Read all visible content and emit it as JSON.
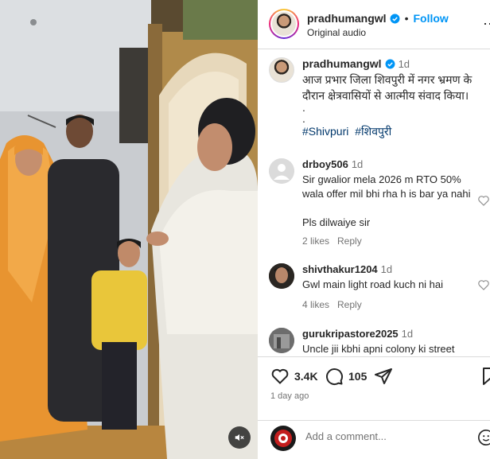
{
  "header": {
    "username": "pradhumangwl",
    "follow_label": "Follow",
    "separator": "•",
    "audio_label": "Original audio",
    "more_icon": "more-horizontal-icon"
  },
  "caption": {
    "username": "pradhumangwl",
    "time": "1d",
    "text": "आज प्रभार जिला शिवपुरी में नगर भ्रमण के दौरान क्षेत्रवासियों से आत्मीय संवाद किया।",
    "dot1": ".",
    "dot2": ".",
    "tags": [
      "#Shivpuri",
      "#शिवपुरी"
    ]
  },
  "comments": [
    {
      "username": "drboy506",
      "time": "1d",
      "text": "Sir gwalior mela 2026 m RTO 50% wala offer mil bhi rha h is bar ya nahi",
      "text2": "Pls dilwaiye sir",
      "likes": "2 likes",
      "reply": "Reply"
    },
    {
      "username": "shivthakur1204",
      "time": "1d",
      "text": "Gwl main light road kuch ni hai",
      "likes": "4 likes",
      "reply": "Reply"
    },
    {
      "username": "gurukripastore2025",
      "time": "1d",
      "text": "Uncle jii kbhi apni colony ki street"
    }
  ],
  "actions": {
    "likes_count": "3.4K",
    "comments_count": "105",
    "posted": "1 day ago"
  },
  "add_comment": {
    "placeholder": "Add a comment..."
  },
  "colors": {
    "accent": "#0095f6",
    "hashtag": "#00376b",
    "muted": "#737373"
  }
}
